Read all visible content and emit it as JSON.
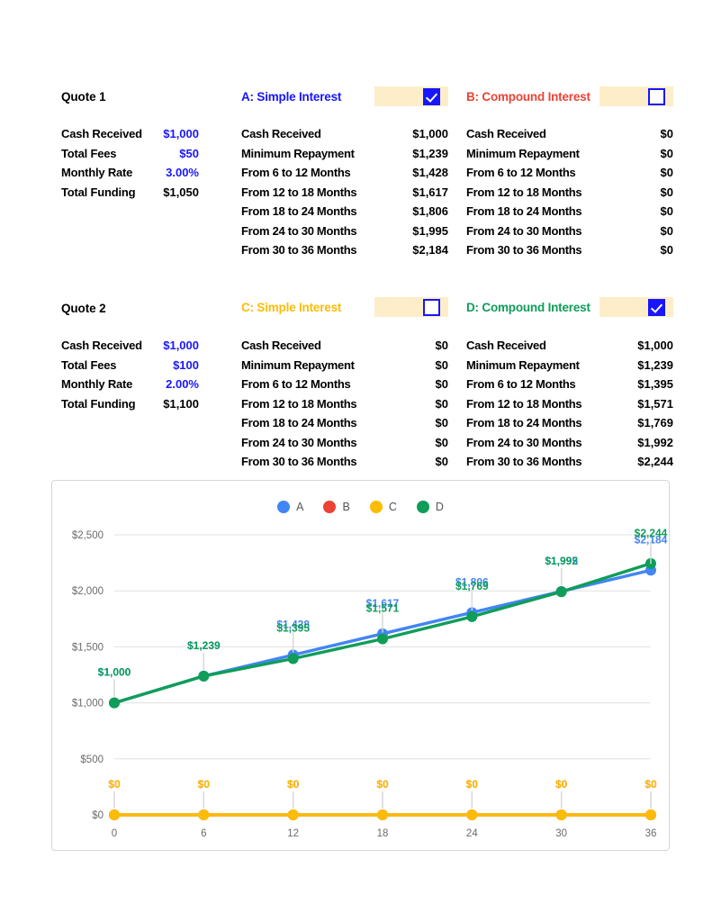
{
  "quotes": [
    {
      "title": "Quote 1",
      "rows": [
        {
          "label": "Cash Received",
          "value": "$1,000",
          "style": "blue"
        },
        {
          "label": "Total Fees",
          "value": "$50",
          "style": "blue"
        },
        {
          "label": "Monthly Rate",
          "value": "3.00%",
          "style": "blue"
        },
        {
          "label": "Total Funding",
          "value": "$1,050",
          "style": "black"
        }
      ]
    },
    {
      "title": "Quote 2",
      "rows": [
        {
          "label": "Cash Received",
          "value": "$1,000",
          "style": "blue"
        },
        {
          "label": "Total Fees",
          "value": "$100",
          "style": "blue"
        },
        {
          "label": "Monthly Rate",
          "value": "2.00%",
          "style": "blue"
        },
        {
          "label": "Total Funding",
          "value": "$1,100",
          "style": "black"
        }
      ]
    }
  ],
  "options": [
    {
      "key": "A",
      "heading": "A: Simple Interest",
      "color": "#1815ff",
      "checked": true,
      "rows": [
        {
          "label": "Cash Received",
          "value": "$1,000"
        },
        {
          "label": "Minimum Repayment",
          "value": "$1,239"
        },
        {
          "label": "From 6 to 12 Months",
          "value": "$1,428"
        },
        {
          "label": "From 12 to 18 Months",
          "value": "$1,617"
        },
        {
          "label": "From 18 to 24 Months",
          "value": "$1,806"
        },
        {
          "label": "From 24 to 30 Months",
          "value": "$1,995"
        },
        {
          "label": "From 30 to 36 Months",
          "value": "$2,184"
        }
      ]
    },
    {
      "key": "B",
      "heading": "B: Compound Interest",
      "color": "#ea4335",
      "checked": false,
      "rows": [
        {
          "label": "Cash Received",
          "value": "$0"
        },
        {
          "label": "Minimum Repayment",
          "value": "$0"
        },
        {
          "label": "From 6 to 12 Months",
          "value": "$0"
        },
        {
          "label": "From 12 to 18 Months",
          "value": "$0"
        },
        {
          "label": "From 18 to 24 Months",
          "value": "$0"
        },
        {
          "label": "From 24 to 30 Months",
          "value": "$0"
        },
        {
          "label": "From 30 to 36 Months",
          "value": "$0"
        }
      ]
    },
    {
      "key": "C",
      "heading": "C: Simple Interest",
      "color": "#fbbc05",
      "checked": false,
      "rows": [
        {
          "label": "Cash Received",
          "value": "$0"
        },
        {
          "label": "Minimum Repayment",
          "value": "$0"
        },
        {
          "label": "From 6 to 12 Months",
          "value": "$0"
        },
        {
          "label": "From 12 to 18 Months",
          "value": "$0"
        },
        {
          "label": "From 18 to 24 Months",
          "value": "$0"
        },
        {
          "label": "From 24 to 30 Months",
          "value": "$0"
        },
        {
          "label": "From 30 to 36 Months",
          "value": "$0"
        }
      ]
    },
    {
      "key": "D",
      "heading": "D: Compound Interest",
      "color": "#0f9d58",
      "checked": true,
      "rows": [
        {
          "label": "Cash Received",
          "value": "$1,000"
        },
        {
          "label": "Minimum Repayment",
          "value": "$1,239"
        },
        {
          "label": "From 6 to 12 Months",
          "value": "$1,395"
        },
        {
          "label": "From 12 to 18 Months",
          "value": "$1,571"
        },
        {
          "label": "From 18 to 24 Months",
          "value": "$1,769"
        },
        {
          "label": "From 24 to 30 Months",
          "value": "$1,992"
        },
        {
          "label": "From 30 to 36 Months",
          "value": "$2,244"
        }
      ]
    }
  ],
  "chart_data": {
    "type": "line",
    "title": "",
    "xlabel": "",
    "ylabel": "",
    "x": [
      0,
      6,
      12,
      18,
      24,
      30,
      36
    ],
    "xtick_labels": [
      "0",
      "6",
      "12",
      "18",
      "24",
      "30",
      "36"
    ],
    "ytick_labels": [
      "$0",
      "$500",
      "$1,000",
      "$1,500",
      "$2,000",
      "$2,500"
    ],
    "ytick_values": [
      0,
      500,
      1000,
      1500,
      2000,
      2500
    ],
    "ylim": [
      0,
      2500
    ],
    "grid": true,
    "legend_position": "top-center",
    "legend": [
      "A",
      "B",
      "C",
      "D"
    ],
    "series": [
      {
        "name": "A",
        "color": "#4285f4",
        "values": [
          1000,
          1239,
          1428,
          1617,
          1806,
          1995,
          2184
        ],
        "point_labels": [
          "$1,000",
          "$1,239",
          "$1,428",
          "$1,617",
          "$1,806",
          "$1,995",
          "$2,184"
        ]
      },
      {
        "name": "B",
        "color": "#ea4335",
        "values": [
          0,
          0,
          0,
          0,
          0,
          0,
          0
        ],
        "point_labels": [
          "$0",
          "$0",
          "$0",
          "$0",
          "$0",
          "$0",
          "$0"
        ]
      },
      {
        "name": "C",
        "color": "#fbbc05",
        "values": [
          0,
          0,
          0,
          0,
          0,
          0,
          0
        ],
        "point_labels": [
          "$0",
          "$0",
          "$0",
          "$0",
          "$0",
          "$0",
          "$0"
        ]
      },
      {
        "name": "D",
        "color": "#0f9d58",
        "values": [
          1000,
          1239,
          1395,
          1571,
          1769,
          1992,
          2244
        ],
        "point_labels": [
          "$1,000",
          "$1,239",
          "$1,395",
          "$1,571",
          "$1,769",
          "$1,992",
          "$2,244"
        ]
      }
    ]
  }
}
